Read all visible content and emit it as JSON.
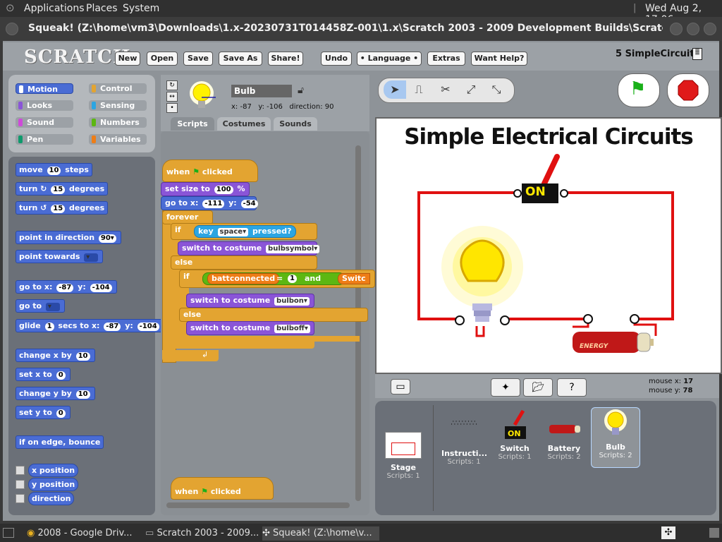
{
  "system": {
    "menu_applications": "Applications",
    "menu_places": "Places",
    "menu_system": "System",
    "clock": "Wed Aug  2, 17:06"
  },
  "window": {
    "title": "Squeak! (Z:\\home\\vm3\\Downloads\\1.x-20230731T014458Z-001\\1.x\\Scratch 2003 - 2009 Development Builds\\Scratch1.3.1v3\\Scratch1.3.1v3\\Scr..."
  },
  "scratch": {
    "logo": "SCRATCH",
    "menu": [
      "New",
      "Open",
      "Save",
      "Save As",
      "Share!",
      "Undo",
      "• Language •",
      "Extras",
      "Want Help?"
    ],
    "project_name": "5 SimpleCircuit"
  },
  "categories": [
    {
      "label": "Motion",
      "color": "#4a6cd4"
    },
    {
      "label": "Control",
      "color": "#e3a431"
    },
    {
      "label": "Looks",
      "color": "#8a55d7"
    },
    {
      "label": "Sensing",
      "color": "#2ca5e2"
    },
    {
      "label": "Sound",
      "color": "#cf4ad9"
    },
    {
      "label": "Numbers",
      "color": "#5cb712"
    },
    {
      "label": "Pen",
      "color": "#0e9a6c"
    },
    {
      "label": "Variables",
      "color": "#ee7d16"
    }
  ],
  "palette": {
    "move": "move",
    "move_val": "10",
    "move_suffix": "steps",
    "turn_r": "turn ↻",
    "turn_r_val": "15",
    "turn_r_suffix": "degrees",
    "turn_l": "turn ↺",
    "turn_l_val": "15",
    "turn_l_suffix": "degrees",
    "point_dir": "point in direction",
    "point_dir_val": "90▾",
    "point_towards": "point towards",
    "goto_xy": "go to x:",
    "goto_x": "-87",
    "goto_y_lbl": "y:",
    "goto_y": "-104",
    "goto": "go to",
    "glide": "glide",
    "glide_val": "1",
    "glide_mid": "secs to x:",
    "glide_x": "-87",
    "glide_y_lbl": "y:",
    "glide_y": "-104",
    "change_x": "change x by",
    "change_x_val": "10",
    "set_x": "set x to",
    "set_x_val": "0",
    "change_y": "change y by",
    "change_y_val": "10",
    "set_y": "set y to",
    "set_y_val": "0",
    "bounce": "if on edge, bounce",
    "x_pos": "x position",
    "y_pos": "y position",
    "direction": "direction"
  },
  "sprite": {
    "name": "Bulb",
    "x_lbl": "x:",
    "x": "-87",
    "y_lbl": "y:",
    "y": "-106",
    "dir_lbl": "direction:",
    "dir": "90"
  },
  "tabs": [
    "Scripts",
    "Costumes",
    "Sounds"
  ],
  "script": {
    "when_clicked": "when",
    "clicked": "clicked",
    "set_size": "set size to",
    "set_size_val": "100",
    "set_size_pct": "%",
    "goto": "go to x:",
    "goto_x": "-111",
    "goto_y_lbl": "y:",
    "goto_y": "-54",
    "forever": "forever",
    "if1": "if",
    "key": "key",
    "key_val": "space▾",
    "pressed": "pressed?",
    "switch1": "switch to costume",
    "switch1_val": "bulbsymbol▾",
    "else1": "else",
    "if2": "if",
    "battconnected": "battconnected",
    "eq": "=",
    "eq_val": "1",
    "and": "and",
    "switch_var": "Switc",
    "switch2": "switch to costume",
    "switch2_val": "bulbon▾",
    "else2": "else",
    "switch3": "switch to costume",
    "switch3_val": "bulboff▾",
    "when2": "when",
    "clicked2": "clicked"
  },
  "stage": {
    "title": "Simple Electrical Circuits",
    "switch_label": "ON",
    "battery_label": "ENERGY",
    "mouse_x_lbl": "mouse x:",
    "mouse_x": "17",
    "mouse_y_lbl": "mouse y:",
    "mouse_y": "78"
  },
  "sprites": [
    {
      "name": "Stage",
      "scripts": "Scripts: 1"
    },
    {
      "name": "Instructi...",
      "scripts": "Scripts: 1"
    },
    {
      "name": "Switch",
      "scripts": "Scripts: 1"
    },
    {
      "name": "Battery",
      "scripts": "Scripts: 2"
    },
    {
      "name": "Bulb",
      "scripts": "Scripts: 2"
    }
  ],
  "taskbar": [
    {
      "label": "2008 - Google Driv..."
    },
    {
      "label": "Scratch 2003 - 2009..."
    },
    {
      "label": "Squeak! (Z:\\home\\v..."
    }
  ]
}
